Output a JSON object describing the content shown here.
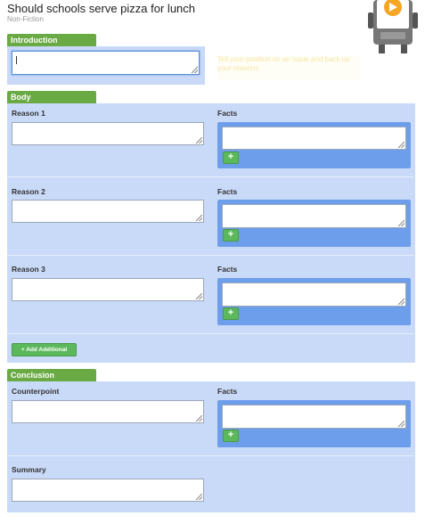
{
  "header": {
    "title": "Should schools serve pizza for lunch",
    "genre": "Non-Fiction"
  },
  "hint": "Tell your position on an issue and back up your reasons",
  "sections": {
    "introduction": {
      "label": "Introduction"
    },
    "body": {
      "label": "Body",
      "reasons": [
        {
          "label": "Reason 1",
          "facts_label": "Facts"
        },
        {
          "label": "Reason 2",
          "facts_label": "Facts"
        },
        {
          "label": "Reason 3",
          "facts_label": "Facts"
        }
      ],
      "add_additional": "+ Add Additional"
    },
    "conclusion": {
      "label": "Conclusion",
      "counterpoint_label": "Counterpoint",
      "facts_label": "Facts",
      "summary_label": "Summary"
    }
  },
  "plus_symbol": "+",
  "colors": {
    "tab_green": "#6aaa45",
    "panel_blue": "#c9daf8",
    "facts_blue": "#6d9eeb",
    "button_green": "#5cb85c"
  },
  "icons": {
    "mascot": "robot-mascot-icon",
    "play": "play-icon"
  }
}
